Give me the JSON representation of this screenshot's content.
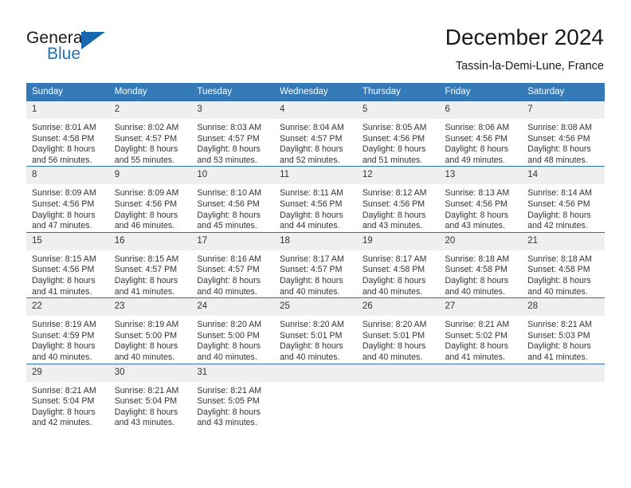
{
  "brand": {
    "name_top": "General",
    "name_bottom": "Blue",
    "logo_icon": "triangle-logo-icon",
    "accent_color": "#1667ae",
    "blue_text_color": "#2272b8"
  },
  "header": {
    "title": "December 2024",
    "subtitle": "Tassin-la-Demi-Lune, France"
  },
  "calendar": {
    "header_bg": "#3479b8",
    "daynum_bg": "#efefef",
    "row_border_color": "#2f6fae",
    "weekday_headers": [
      "Sunday",
      "Monday",
      "Tuesday",
      "Wednesday",
      "Thursday",
      "Friday",
      "Saturday"
    ],
    "labels": {
      "sunrise_prefix": "Sunrise:",
      "sunset_prefix": "Sunset:",
      "daylight_prefix": "Daylight:"
    },
    "weeks": [
      [
        {
          "day": "1",
          "sunrise": "Sunrise: 8:01 AM",
          "sunset": "Sunset: 4:58 PM",
          "daylight_line1": "Daylight: 8 hours",
          "daylight_line2": "and 56 minutes."
        },
        {
          "day": "2",
          "sunrise": "Sunrise: 8:02 AM",
          "sunset": "Sunset: 4:57 PM",
          "daylight_line1": "Daylight: 8 hours",
          "daylight_line2": "and 55 minutes."
        },
        {
          "day": "3",
          "sunrise": "Sunrise: 8:03 AM",
          "sunset": "Sunset: 4:57 PM",
          "daylight_line1": "Daylight: 8 hours",
          "daylight_line2": "and 53 minutes."
        },
        {
          "day": "4",
          "sunrise": "Sunrise: 8:04 AM",
          "sunset": "Sunset: 4:57 PM",
          "daylight_line1": "Daylight: 8 hours",
          "daylight_line2": "and 52 minutes."
        },
        {
          "day": "5",
          "sunrise": "Sunrise: 8:05 AM",
          "sunset": "Sunset: 4:56 PM",
          "daylight_line1": "Daylight: 8 hours",
          "daylight_line2": "and 51 minutes."
        },
        {
          "day": "6",
          "sunrise": "Sunrise: 8:06 AM",
          "sunset": "Sunset: 4:56 PM",
          "daylight_line1": "Daylight: 8 hours",
          "daylight_line2": "and 49 minutes."
        },
        {
          "day": "7",
          "sunrise": "Sunrise: 8:08 AM",
          "sunset": "Sunset: 4:56 PM",
          "daylight_line1": "Daylight: 8 hours",
          "daylight_line2": "and 48 minutes."
        }
      ],
      [
        {
          "day": "8",
          "sunrise": "Sunrise: 8:09 AM",
          "sunset": "Sunset: 4:56 PM",
          "daylight_line1": "Daylight: 8 hours",
          "daylight_line2": "and 47 minutes."
        },
        {
          "day": "9",
          "sunrise": "Sunrise: 8:09 AM",
          "sunset": "Sunset: 4:56 PM",
          "daylight_line1": "Daylight: 8 hours",
          "daylight_line2": "and 46 minutes."
        },
        {
          "day": "10",
          "sunrise": "Sunrise: 8:10 AM",
          "sunset": "Sunset: 4:56 PM",
          "daylight_line1": "Daylight: 8 hours",
          "daylight_line2": "and 45 minutes."
        },
        {
          "day": "11",
          "sunrise": "Sunrise: 8:11 AM",
          "sunset": "Sunset: 4:56 PM",
          "daylight_line1": "Daylight: 8 hours",
          "daylight_line2": "and 44 minutes."
        },
        {
          "day": "12",
          "sunrise": "Sunrise: 8:12 AM",
          "sunset": "Sunset: 4:56 PM",
          "daylight_line1": "Daylight: 8 hours",
          "daylight_line2": "and 43 minutes."
        },
        {
          "day": "13",
          "sunrise": "Sunrise: 8:13 AM",
          "sunset": "Sunset: 4:56 PM",
          "daylight_line1": "Daylight: 8 hours",
          "daylight_line2": "and 43 minutes."
        },
        {
          "day": "14",
          "sunrise": "Sunrise: 8:14 AM",
          "sunset": "Sunset: 4:56 PM",
          "daylight_line1": "Daylight: 8 hours",
          "daylight_line2": "and 42 minutes."
        }
      ],
      [
        {
          "day": "15",
          "sunrise": "Sunrise: 8:15 AM",
          "sunset": "Sunset: 4:56 PM",
          "daylight_line1": "Daylight: 8 hours",
          "daylight_line2": "and 41 minutes."
        },
        {
          "day": "16",
          "sunrise": "Sunrise: 8:15 AM",
          "sunset": "Sunset: 4:57 PM",
          "daylight_line1": "Daylight: 8 hours",
          "daylight_line2": "and 41 minutes."
        },
        {
          "day": "17",
          "sunrise": "Sunrise: 8:16 AM",
          "sunset": "Sunset: 4:57 PM",
          "daylight_line1": "Daylight: 8 hours",
          "daylight_line2": "and 40 minutes."
        },
        {
          "day": "18",
          "sunrise": "Sunrise: 8:17 AM",
          "sunset": "Sunset: 4:57 PM",
          "daylight_line1": "Daylight: 8 hours",
          "daylight_line2": "and 40 minutes."
        },
        {
          "day": "19",
          "sunrise": "Sunrise: 8:17 AM",
          "sunset": "Sunset: 4:58 PM",
          "daylight_line1": "Daylight: 8 hours",
          "daylight_line2": "and 40 minutes."
        },
        {
          "day": "20",
          "sunrise": "Sunrise: 8:18 AM",
          "sunset": "Sunset: 4:58 PM",
          "daylight_line1": "Daylight: 8 hours",
          "daylight_line2": "and 40 minutes."
        },
        {
          "day": "21",
          "sunrise": "Sunrise: 8:18 AM",
          "sunset": "Sunset: 4:58 PM",
          "daylight_line1": "Daylight: 8 hours",
          "daylight_line2": "and 40 minutes."
        }
      ],
      [
        {
          "day": "22",
          "sunrise": "Sunrise: 8:19 AM",
          "sunset": "Sunset: 4:59 PM",
          "daylight_line1": "Daylight: 8 hours",
          "daylight_line2": "and 40 minutes."
        },
        {
          "day": "23",
          "sunrise": "Sunrise: 8:19 AM",
          "sunset": "Sunset: 5:00 PM",
          "daylight_line1": "Daylight: 8 hours",
          "daylight_line2": "and 40 minutes."
        },
        {
          "day": "24",
          "sunrise": "Sunrise: 8:20 AM",
          "sunset": "Sunset: 5:00 PM",
          "daylight_line1": "Daylight: 8 hours",
          "daylight_line2": "and 40 minutes."
        },
        {
          "day": "25",
          "sunrise": "Sunrise: 8:20 AM",
          "sunset": "Sunset: 5:01 PM",
          "daylight_line1": "Daylight: 8 hours",
          "daylight_line2": "and 40 minutes."
        },
        {
          "day": "26",
          "sunrise": "Sunrise: 8:20 AM",
          "sunset": "Sunset: 5:01 PM",
          "daylight_line1": "Daylight: 8 hours",
          "daylight_line2": "and 40 minutes."
        },
        {
          "day": "27",
          "sunrise": "Sunrise: 8:21 AM",
          "sunset": "Sunset: 5:02 PM",
          "daylight_line1": "Daylight: 8 hours",
          "daylight_line2": "and 41 minutes."
        },
        {
          "day": "28",
          "sunrise": "Sunrise: 8:21 AM",
          "sunset": "Sunset: 5:03 PM",
          "daylight_line1": "Daylight: 8 hours",
          "daylight_line2": "and 41 minutes."
        }
      ],
      [
        {
          "day": "29",
          "sunrise": "Sunrise: 8:21 AM",
          "sunset": "Sunset: 5:04 PM",
          "daylight_line1": "Daylight: 8 hours",
          "daylight_line2": "and 42 minutes."
        },
        {
          "day": "30",
          "sunrise": "Sunrise: 8:21 AM",
          "sunset": "Sunset: 5:04 PM",
          "daylight_line1": "Daylight: 8 hours",
          "daylight_line2": "and 43 minutes."
        },
        {
          "day": "31",
          "sunrise": "Sunrise: 8:21 AM",
          "sunset": "Sunset: 5:05 PM",
          "daylight_line1": "Daylight: 8 hours",
          "daylight_line2": "and 43 minutes."
        },
        {
          "day": "",
          "sunrise": "",
          "sunset": "",
          "daylight_line1": "",
          "daylight_line2": ""
        },
        {
          "day": "",
          "sunrise": "",
          "sunset": "",
          "daylight_line1": "",
          "daylight_line2": ""
        },
        {
          "day": "",
          "sunrise": "",
          "sunset": "",
          "daylight_line1": "",
          "daylight_line2": ""
        },
        {
          "day": "",
          "sunrise": "",
          "sunset": "",
          "daylight_line1": "",
          "daylight_line2": ""
        }
      ]
    ]
  }
}
